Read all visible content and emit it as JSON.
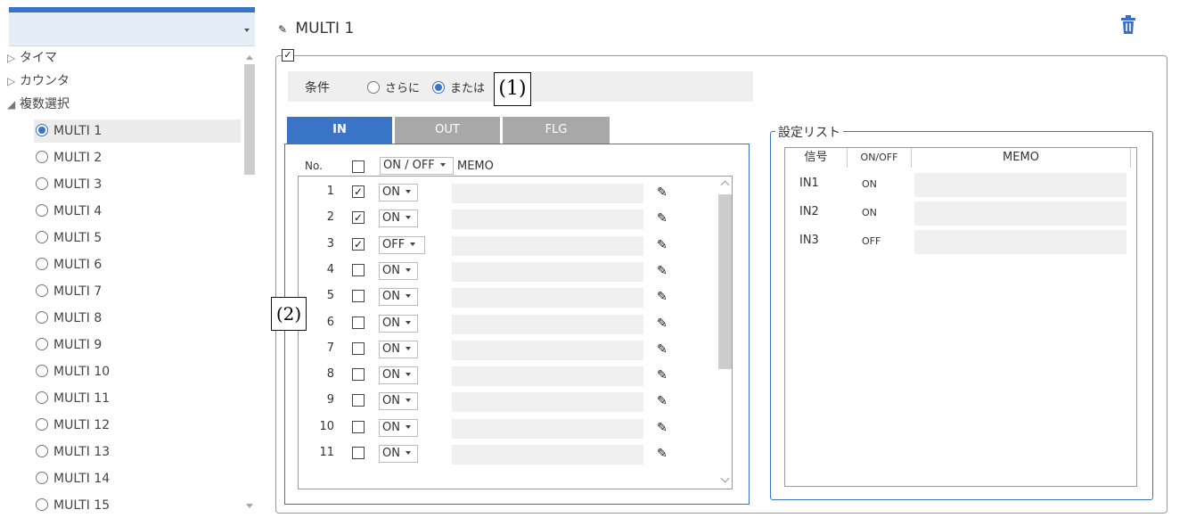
{
  "sidebar": {
    "groups": [
      {
        "label": "タイマ",
        "expanded": false
      },
      {
        "label": "カウンタ",
        "expanded": false
      },
      {
        "label": "複数選択",
        "expanded": true
      }
    ],
    "items": [
      "MULTI 1",
      "MULTI 2",
      "MULTI 3",
      "MULTI 4",
      "MULTI 5",
      "MULTI 6",
      "MULTI 7",
      "MULTI 8",
      "MULTI 9",
      "MULTI 10",
      "MULTI 11",
      "MULTI 12",
      "MULTI 13",
      "MULTI 14",
      "MULTI 15"
    ],
    "selected_index": 0
  },
  "main": {
    "title": "MULTI 1",
    "enabled": true,
    "condition": {
      "label": "条件",
      "options": [
        "さらに",
        "または"
      ],
      "selected": "または"
    },
    "callouts": [
      "(1)",
      "(2)"
    ],
    "tabs": [
      "IN",
      "OUT",
      "FLG"
    ],
    "active_tab": "IN",
    "in_header": {
      "no": "No.",
      "onoff": "ON / OFF",
      "memo": "MEMO"
    },
    "rows": [
      {
        "no": "1",
        "checked": true,
        "value": "ON"
      },
      {
        "no": "2",
        "checked": true,
        "value": "ON"
      },
      {
        "no": "3",
        "checked": true,
        "value": "OFF"
      },
      {
        "no": "4",
        "checked": false,
        "value": "ON"
      },
      {
        "no": "5",
        "checked": false,
        "value": "ON"
      },
      {
        "no": "6",
        "checked": false,
        "value": "ON"
      },
      {
        "no": "7",
        "checked": false,
        "value": "ON"
      },
      {
        "no": "8",
        "checked": false,
        "value": "ON"
      },
      {
        "no": "9",
        "checked": false,
        "value": "ON"
      },
      {
        "no": "10",
        "checked": false,
        "value": "ON"
      },
      {
        "no": "11",
        "checked": false,
        "value": "ON"
      }
    ]
  },
  "settings_list": {
    "legend": "設定リスト",
    "columns": [
      "信号",
      "ON/OFF",
      "MEMO"
    ],
    "rows": [
      {
        "signal": "IN1",
        "onoff": "ON"
      },
      {
        "signal": "IN2",
        "onoff": "ON"
      },
      {
        "signal": "IN3",
        "onoff": "OFF"
      }
    ]
  },
  "colors": {
    "accent": "#3a74c7",
    "tab_inactive": "#a8a8a8",
    "field_bg": "#f0f0f0"
  },
  "icons": {
    "edit": "pencil-icon",
    "delete": "trash-icon"
  }
}
